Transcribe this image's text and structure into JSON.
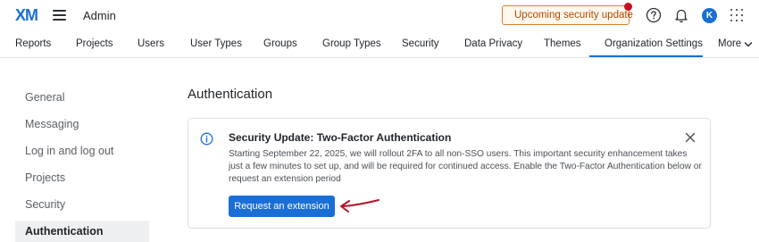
{
  "header": {
    "logo": "XM",
    "title": "Admin",
    "security_update_label": "Upcoming security update",
    "avatar_initial": "K"
  },
  "nav": {
    "tabs": [
      {
        "label": "Reports"
      },
      {
        "label": "Projects"
      },
      {
        "label": "Users"
      },
      {
        "label": "User Types"
      },
      {
        "label": "Groups"
      },
      {
        "label": "Group Types"
      },
      {
        "label": "Security"
      },
      {
        "label": "Data Privacy"
      },
      {
        "label": "Themes"
      },
      {
        "label": "Organization Settings"
      },
      {
        "label": "More"
      }
    ],
    "active_tab": "Organization Settings"
  },
  "sidebar": {
    "items": [
      {
        "label": "General"
      },
      {
        "label": "Messaging"
      },
      {
        "label": "Log in and log out"
      },
      {
        "label": "Projects"
      },
      {
        "label": "Security"
      },
      {
        "label": "Authentication"
      }
    ],
    "active_item": "Authentication"
  },
  "main": {
    "title": "Authentication",
    "notice": {
      "title": "Security Update: Two-Factor Authentication",
      "body": "Starting September 22, 2025, we will rollout 2FA to all non-SSO users. This important security enhancement takes just a few minutes to set up, and will be required for continued access. Enable the Two-Factor Authentication below or request an extension period",
      "button_label": "Request an extension"
    }
  },
  "colors": {
    "accent": "#1a6fd6",
    "warning_border": "#d9822b",
    "warning_text": "#b04a00",
    "notification_dot": "#c50f1f",
    "annotation_arrow": "#b0162b"
  }
}
